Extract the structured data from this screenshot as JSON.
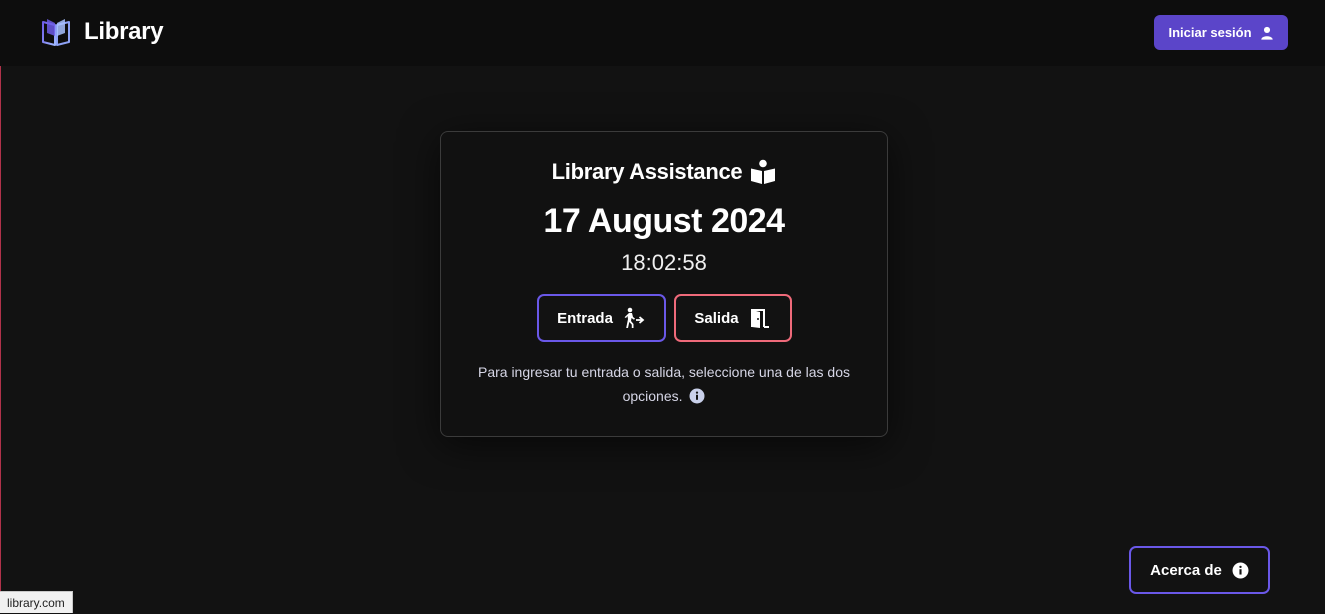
{
  "header": {
    "brand_name": "Library",
    "brand_icon": "book-open-icon",
    "login_label": "Iniciar sesión",
    "login_icon": "user-icon",
    "accent": "#5b45c9"
  },
  "card": {
    "title": "Library Assistance",
    "title_icon": "book-reader-icon",
    "date": "17 August 2024",
    "time": "18:02:58",
    "entry_label": "Entrada",
    "entry_icon": "person-walking-arrow-right-icon",
    "exit_label": "Salida",
    "exit_icon": "door-open-icon",
    "hint_text": "Para ingresar tu entrada o salida, seleccione una de las dos opciones.",
    "hint_icon": "info-circle-icon"
  },
  "footer": {
    "about_label": "Acerca de",
    "about_icon": "info-circle-icon",
    "status_url": "library.com"
  },
  "colors": {
    "background": "#121212",
    "entry_border": "#6a58e8",
    "exit_border": "#ef6a7a"
  }
}
